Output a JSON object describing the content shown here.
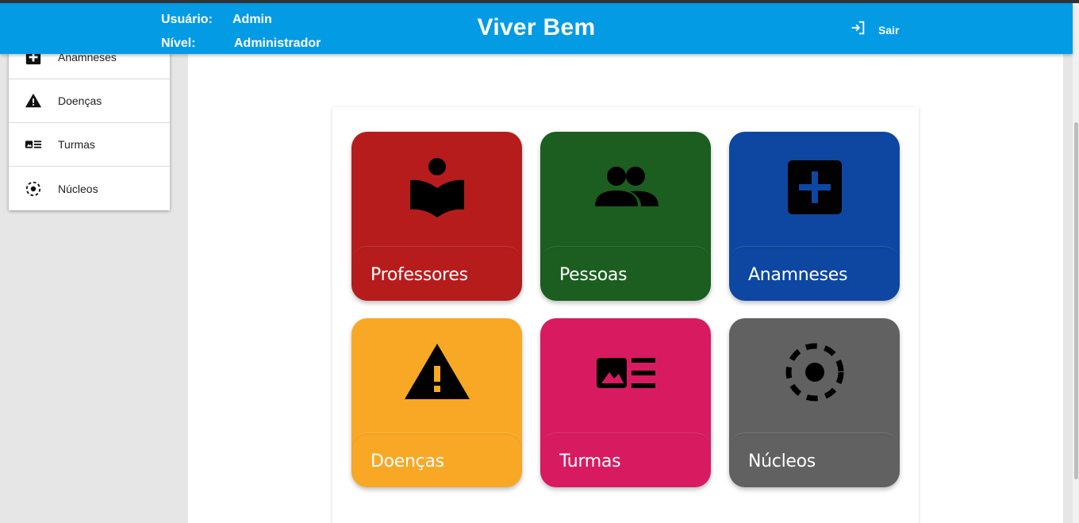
{
  "header": {
    "user_key": "Usuário:",
    "user_value": "Admin",
    "level_key": "Nível:",
    "level_value": "Administrador",
    "title": "Viver Bem",
    "logout_label": "Sair",
    "logout_icon": "exit-icon",
    "background": "#049be5"
  },
  "sidebar": {
    "items": [
      {
        "label": "Anamneses",
        "icon": "medical-plus-icon"
      },
      {
        "label": "Doenças",
        "icon": "warning-icon"
      },
      {
        "label": "Turmas",
        "icon": "class-card-icon"
      },
      {
        "label": "Núcleos",
        "icon": "dashed-circle-icon"
      }
    ]
  },
  "tiles": [
    {
      "label": "Professores",
      "icon": "reading-teacher-icon",
      "color": "#b71c1c"
    },
    {
      "label": "Pessoas",
      "icon": "people-icon",
      "color": "#1b5e20"
    },
    {
      "label": "Anamneses",
      "icon": "medical-plus-icon",
      "color": "#0d47a1"
    },
    {
      "label": "Doenças",
      "icon": "warning-icon",
      "color": "#f9a825"
    },
    {
      "label": "Turmas",
      "icon": "class-card-icon",
      "color": "#d81b60"
    },
    {
      "label": "Núcleos",
      "icon": "dashed-circle-icon",
      "color": "#616161"
    }
  ]
}
